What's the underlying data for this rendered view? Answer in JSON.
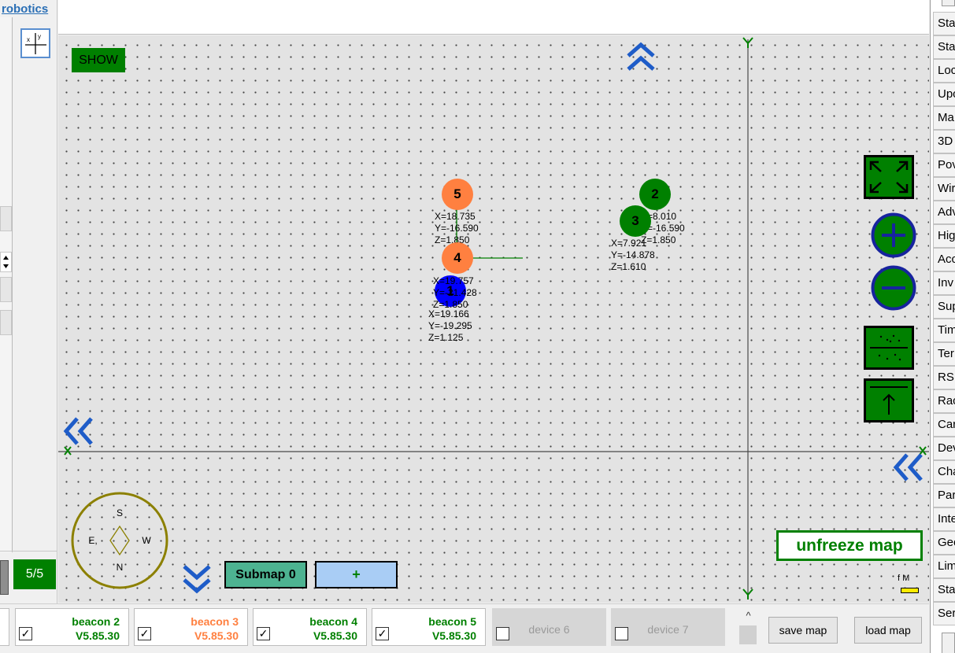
{
  "app": {
    "brand": "robotics"
  },
  "left_panel": {
    "counter": "5/5"
  },
  "map": {
    "show_button": "SHOW",
    "axis_labels": {
      "y_top": "Y",
      "y_bottom": "Y",
      "x_left": "X",
      "x_right": "X"
    },
    "compass": {
      "north": "N",
      "south": "S",
      "east": "E,",
      "west": "W"
    },
    "beacons": [
      {
        "number": "5",
        "color": "#ff8040",
        "coords": "X=18.735\nY=-16.590\nZ=1.850"
      },
      {
        "number": "4",
        "color": "#ff8040",
        "coords": "X=19.757\nY=-21.428\nZ=1.850"
      },
      {
        "number": "2",
        "color": "#008000",
        "coords": "X=8.010\nY=-16.590\nZ=1.850"
      },
      {
        "number": "3",
        "color": "#008000",
        "coords": "X=7.921\nY=-14.878\nZ=1.610"
      },
      {
        "number": "1",
        "color": "#0000ff",
        "coords": "X=19.166\nY=-19.295\nZ=1.125"
      }
    ],
    "submap_label": "Submap 0",
    "add_submap_label": "+",
    "unfreeze_label": "unfreeze map",
    "scale_label": "f M"
  },
  "bottom_bar": {
    "devices": [
      {
        "name": "beacon 2",
        "version": "V5.85.30",
        "checked": true,
        "color": "#008000",
        "active": true
      },
      {
        "name": "beacon 3",
        "version": "V5.85.30",
        "checked": true,
        "color": "#ff8040",
        "active": true
      },
      {
        "name": "beacon 4",
        "version": "V5.85.30",
        "checked": true,
        "color": "#008000",
        "active": true
      },
      {
        "name": "beacon 5",
        "version": "V5.85.30",
        "checked": true,
        "color": "#008000",
        "active": true
      },
      {
        "name": "device 6",
        "version": "",
        "checked": false,
        "color": "#9a9a9a",
        "active": false
      },
      {
        "name": "device 7",
        "version": "",
        "checked": false,
        "color": "#9a9a9a",
        "active": false
      }
    ],
    "scroll_up": "^",
    "save_map": "save map",
    "load_map": "load map"
  },
  "right_panel": {
    "items": [
      "Sta",
      "Sta",
      "Loc",
      "Upc",
      "Ma",
      "3D",
      "Pov",
      "Wir",
      "Adv",
      "Hig",
      "Acc",
      "Inv",
      "Sup",
      "Tim",
      "Ter",
      "RS",
      "Rac",
      "Car",
      "Dev",
      "Cha",
      "Par",
      "Inte",
      "Geo",
      "Lim",
      "Sta",
      "Ser"
    ]
  }
}
